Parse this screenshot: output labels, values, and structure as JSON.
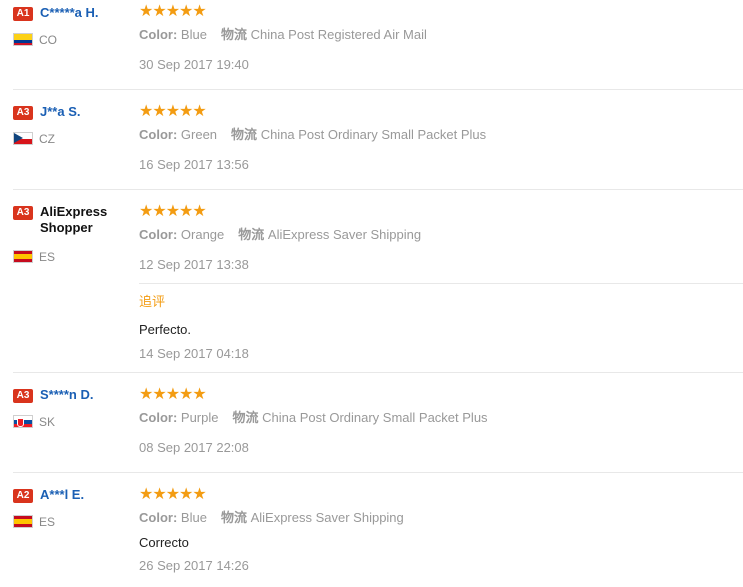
{
  "colors": {
    "badge": "#d9341d",
    "name": "#1a5fb4",
    "star": "#f39c12",
    "muted": "#999999"
  },
  "reviews": [
    {
      "badge": "A1",
      "name": "C*****a H.",
      "country": "CO",
      "rating": 5,
      "stars": "★★★★★",
      "color_label": "Color:",
      "color_value": "Blue",
      "logistics_label": "物流",
      "logistics_value": "China Post Registered Air Mail",
      "date": "30 Sep 2017 19:40"
    },
    {
      "badge": "A3",
      "name": "J**a S.",
      "country": "CZ",
      "rating": 5,
      "stars": "★★★★★",
      "color_label": "Color:",
      "color_value": "Green",
      "logistics_label": "物流",
      "logistics_value": "China Post Ordinary Small Packet Plus",
      "date": "16 Sep 2017 13:56"
    },
    {
      "badge": "A3",
      "name": "AliExpress Shopper",
      "country": "ES",
      "rating": 5,
      "stars": "★★★★★",
      "color_label": "Color:",
      "color_value": "Orange",
      "logistics_label": "物流",
      "logistics_value": "AliExpress Saver Shipping",
      "date": "12 Sep 2017 13:38",
      "followup_label": "追评",
      "followup_text": "Perfecto.",
      "followup_date": "14 Sep 2017 04:18"
    },
    {
      "badge": "A3",
      "name": "S****n D.",
      "country": "SK",
      "rating": 5,
      "stars": "★★★★★",
      "color_label": "Color:",
      "color_value": "Purple",
      "logistics_label": "物流",
      "logistics_value": "China Post Ordinary Small Packet Plus",
      "date": "08 Sep 2017 22:08"
    },
    {
      "badge": "A2",
      "name": "A***l E.",
      "country": "ES",
      "rating": 5,
      "stars": "★★★★★",
      "color_label": "Color:",
      "color_value": "Blue",
      "logistics_label": "物流",
      "logistics_value": "AliExpress Saver Shipping",
      "feedback": "Correcto",
      "date": "26 Sep 2017 14:26"
    }
  ]
}
